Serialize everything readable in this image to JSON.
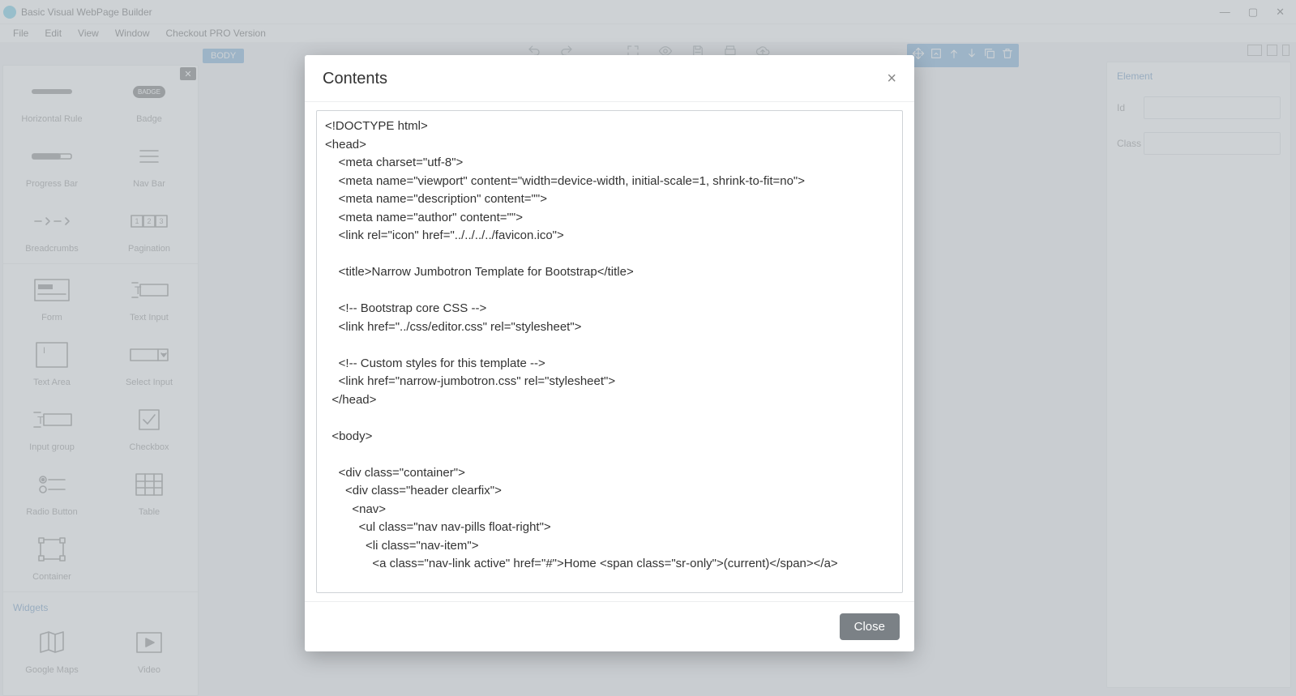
{
  "window": {
    "title": "Basic Visual WebPage Builder"
  },
  "menu": {
    "file": "File",
    "edit": "Edit",
    "view": "View",
    "window": "Window",
    "checkout": "Checkout PRO Version"
  },
  "body_chip": "BODY",
  "widgets": {
    "horizontal_rule": "Horizontal Rule",
    "badge": "Badge",
    "badge_icon_text": "BADGE",
    "progress_bar": "Progress Bar",
    "nav_bar": "Nav Bar",
    "breadcrumbs": "Breadcrumbs",
    "pagination": "Pagination",
    "form": "Form",
    "text_input": "Text Input",
    "text_area": "Text Area",
    "select_input": "Select Input",
    "input_group": "Input group",
    "checkbox": "Checkbox",
    "radio_button": "Radio Button",
    "table": "Table",
    "container": "Container",
    "section_label": "Widgets",
    "google_maps": "Google Maps",
    "video": "Video"
  },
  "element_panel": {
    "header": "Element",
    "id_label": "Id",
    "id_value": "",
    "class_label": "Class",
    "class_value": ""
  },
  "modal": {
    "title": "Contents",
    "close_label": "Close",
    "code": "<!DOCTYPE html>\n<head>\n    <meta charset=\"utf-8\">\n    <meta name=\"viewport\" content=\"width=device-width, initial-scale=1, shrink-to-fit=no\">\n    <meta name=\"description\" content=\"\">\n    <meta name=\"author\" content=\"\">\n    <link rel=\"icon\" href=\"../../../../favicon.ico\">\n\n    <title>Narrow Jumbotron Template for Bootstrap</title>\n\n    <!-- Bootstrap core CSS -->\n    <link href=\"../css/editor.css\" rel=\"stylesheet\">\n\n    <!-- Custom styles for this template -->\n    <link href=\"narrow-jumbotron.css\" rel=\"stylesheet\">\n  </head>\n\n  <body>\n\n    <div class=\"container\">\n      <div class=\"header clearfix\">\n        <nav>\n          <ul class=\"nav nav-pills float-right\">\n            <li class=\"nav-item\">\n              <a class=\"nav-link active\" href=\"#\">Home <span class=\"sr-only\">(current)</span></a>"
  }
}
